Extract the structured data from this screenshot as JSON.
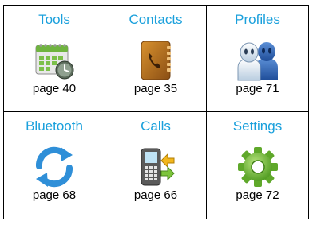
{
  "menu": [
    {
      "title": "Tools",
      "page": "page 40",
      "icon": "calendar-clock-icon"
    },
    {
      "title": "Contacts",
      "page": "page 35",
      "icon": "phonebook-icon"
    },
    {
      "title": "Profiles",
      "page": "page 71",
      "icon": "people-icon"
    },
    {
      "title": "Bluetooth",
      "page": "page 68",
      "icon": "sync-arrows-icon"
    },
    {
      "title": "Calls",
      "page": "page 66",
      "icon": "phone-arrows-icon"
    },
    {
      "title": "Settings",
      "page": "page 72",
      "icon": "gear-icon"
    }
  ],
  "colors": {
    "title": "#1aa0dc",
    "border": "#000000"
  }
}
